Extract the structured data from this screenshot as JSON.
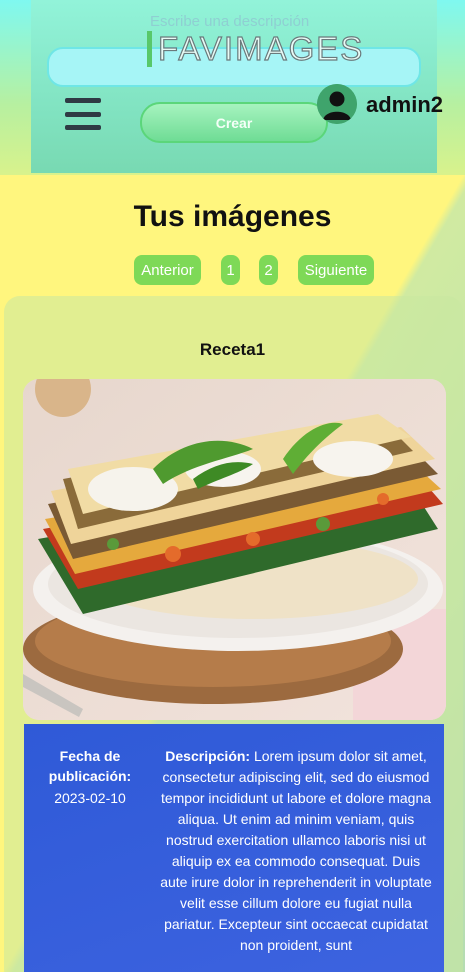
{
  "header": {
    "search_placeholder": "Escribe una descripción",
    "logo_text": "FAVIMAGES",
    "create_label": "Crear",
    "username": "admin2"
  },
  "main": {
    "title": "Tus imágenes",
    "pagination": {
      "prev_label": "Anterior",
      "pages": [
        "1",
        "2"
      ],
      "next_label": "Siguiente"
    }
  },
  "card": {
    "title": "Receta1",
    "date_label": "Fecha de publicación:",
    "date_value": "2023-02-10",
    "description_label": "Descripción:",
    "description_text": "Lorem ipsum dolor sit amet, consectetur adipiscing elit, sed do eiusmod tempor incididunt ut labore et dolore magna aliqua. Ut enim ad minim veniam, quis nostrud exercitation ullamco laboris nisi ut aliquip ex ea commodo consequat. Duis aute irure dolor in reprehenderit in voluptate velit esse cillum dolore eu fugiat nulla pariatur. Excepteur sint occaecat cupidatat non proident, sunt"
  },
  "icons": {
    "menu": "hamburger-menu-icon",
    "user": "user-avatar-icon"
  },
  "colors": {
    "page_bg": "#fff67e",
    "header_bg": "#7fe3c4",
    "pager_green": "#7ed957",
    "info_blue": "#2f5ad7"
  }
}
